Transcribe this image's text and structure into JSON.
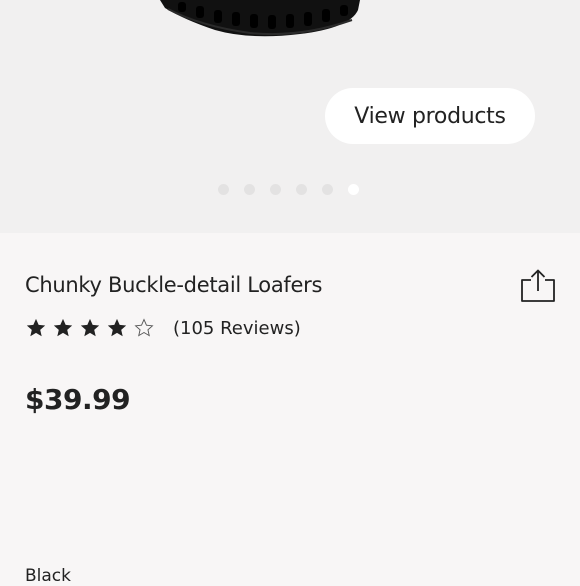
{
  "hero": {
    "view_products_label": "View products",
    "carousel_dot_count": 6,
    "carousel_active_index": 5
  },
  "product": {
    "title": "Chunky Buckle-detail Loafers",
    "rating": 4,
    "rating_max": 5,
    "reviews_text": "(105 Reviews)",
    "price": "$39.99",
    "color_label": "Black"
  },
  "icons": {
    "share": "share-icon",
    "star_filled": "star-filled-icon",
    "star_empty": "star-outline-icon"
  },
  "colors": {
    "hero_background": "#f1f0f0",
    "page_background": "#f8f6f6",
    "text": "#222222",
    "star": "#222222",
    "shoe": "#111111"
  }
}
